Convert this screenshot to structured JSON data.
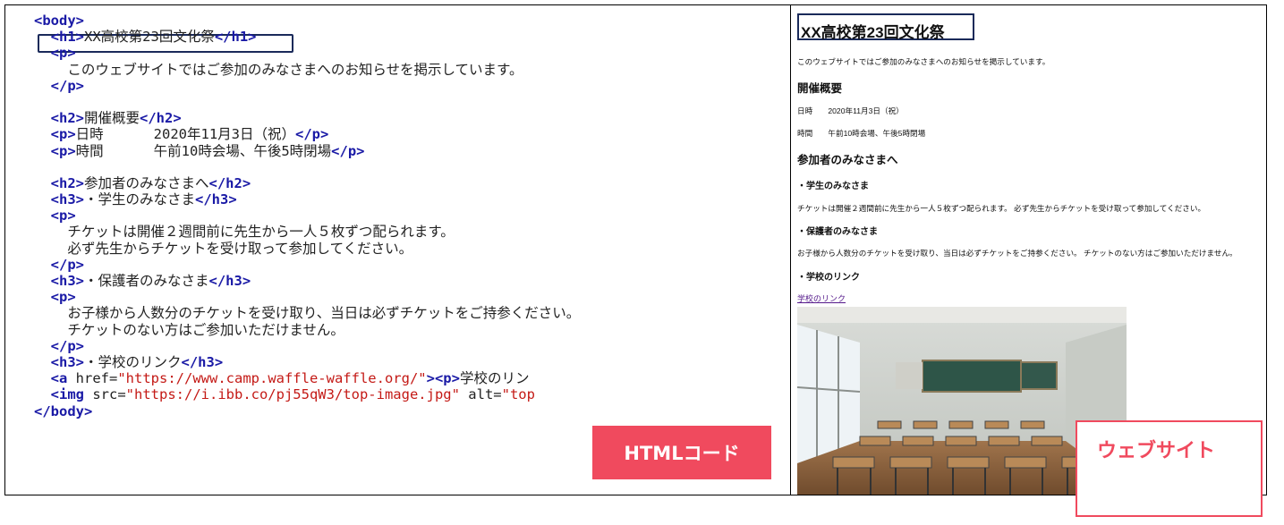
{
  "code_lines": [
    {
      "parts": [
        [
          "tag",
          "<body>"
        ]
      ],
      "indent": 0
    },
    {
      "parts": [
        [
          "tag",
          "<h1>"
        ],
        [
          "txt",
          "XX高校第23回文化祭"
        ],
        [
          "tag",
          "</h1>"
        ]
      ],
      "indent": 2
    },
    {
      "parts": [
        [
          "tag",
          "<p>"
        ]
      ],
      "indent": 2
    },
    {
      "parts": [
        [
          "txt",
          "このウェブサイトではご参加のみなさまへのお知らせを掲示しています。"
        ]
      ],
      "indent": 4
    },
    {
      "parts": [
        [
          "tag",
          "</p>"
        ]
      ],
      "indent": 2
    },
    {
      "parts": [],
      "indent": 0
    },
    {
      "parts": [
        [
          "tag",
          "<h2>"
        ],
        [
          "txt",
          "開催概要"
        ],
        [
          "tag",
          "</h2>"
        ]
      ],
      "indent": 2
    },
    {
      "parts": [
        [
          "tag",
          "<p>"
        ],
        [
          "txt",
          "日時      2020年11月3日（祝）"
        ],
        [
          "tag",
          "</p>"
        ]
      ],
      "indent": 2
    },
    {
      "parts": [
        [
          "tag",
          "<p>"
        ],
        [
          "txt",
          "時間      午前10時会場、午後5時閉場"
        ],
        [
          "tag",
          "</p>"
        ]
      ],
      "indent": 2
    },
    {
      "parts": [],
      "indent": 0
    },
    {
      "parts": [
        [
          "tag",
          "<h2>"
        ],
        [
          "txt",
          "参加者のみなさまへ"
        ],
        [
          "tag",
          "</h2>"
        ]
      ],
      "indent": 2
    },
    {
      "parts": [
        [
          "tag",
          "<h3>"
        ],
        [
          "txt",
          "・学生のみなさま"
        ],
        [
          "tag",
          "</h3>"
        ]
      ],
      "indent": 2
    },
    {
      "parts": [
        [
          "tag",
          "<p>"
        ]
      ],
      "indent": 2
    },
    {
      "parts": [
        [
          "txt",
          "チケットは開催２週間前に先生から一人５枚ずつ配られます。"
        ]
      ],
      "indent": 4
    },
    {
      "parts": [
        [
          "txt",
          "必ず先生からチケットを受け取って参加してください。"
        ]
      ],
      "indent": 4
    },
    {
      "parts": [
        [
          "tag",
          "</p>"
        ]
      ],
      "indent": 2
    },
    {
      "parts": [
        [
          "tag",
          "<h3>"
        ],
        [
          "txt",
          "・保護者のみなさま"
        ],
        [
          "tag",
          "</h3>"
        ]
      ],
      "indent": 2
    },
    {
      "parts": [
        [
          "tag",
          "<p>"
        ]
      ],
      "indent": 2
    },
    {
      "parts": [
        [
          "txt",
          "お子様から人数分のチケットを受け取り、当日は必ずチケットをご持参ください。"
        ]
      ],
      "indent": 4
    },
    {
      "parts": [
        [
          "txt",
          "チケットのない方はご参加いただけません。"
        ]
      ],
      "indent": 4
    },
    {
      "parts": [
        [
          "tag",
          "</p>"
        ]
      ],
      "indent": 2
    },
    {
      "parts": [
        [
          "tag",
          "<h3>"
        ],
        [
          "txt",
          "・学校のリンク"
        ],
        [
          "tag",
          "</h3>"
        ]
      ],
      "indent": 2
    },
    {
      "parts": [
        [
          "tag",
          "<a "
        ],
        [
          "attr",
          "href="
        ],
        [
          "str",
          "\"https://www.camp.waffle-waffle.org/\""
        ],
        [
          "tag",
          "><p>"
        ],
        [
          "txt",
          "学校のリン"
        ]
      ],
      "indent": 2
    },
    {
      "parts": [
        [
          "tag",
          "<img "
        ],
        [
          "attr",
          "src="
        ],
        [
          "str",
          "\"https://i.ibb.co/pj55qW3/top-image.jpg\""
        ],
        [
          "attr",
          " alt="
        ],
        [
          "str",
          "\"top"
        ]
      ],
      "indent": 2
    },
    {
      "parts": [
        [
          "tag",
          "</body>"
        ]
      ],
      "indent": 0
    }
  ],
  "site": {
    "h1": "XX高校第23回文化祭",
    "intro": "このウェブサイトではご参加のみなさまへのお知らせを掲示しています。",
    "h2_overview": "開催概要",
    "date_line": "日時　　2020年11月3日（祝）",
    "time_line": "時間　　午前10時会場、午後5時閉場",
    "h2_participants": "参加者のみなさまへ",
    "h3_students": "・学生のみなさま",
    "p_students": "チケットは開催２週間前に先生から一人５枚ずつ配られます。 必ず先生からチケットを受け取って参加してください。",
    "h3_parents": "・保護者のみなさま",
    "p_parents": "お子様から人数分のチケットを受け取り、当日は必ずチケットをご持参ください。 チケットのない方はご参加いただけません。",
    "h3_link": "・学校のリンク",
    "link_text": "学校のリンク",
    "photo_icon": "classroom-photo"
  },
  "labels": {
    "html_code": "HTMLコード",
    "website": "ウェブサイト"
  },
  "colors": {
    "accent": "#f04a5e",
    "tag": "#1a1aa6",
    "string": "#c41a16",
    "box": "#1a2a5a",
    "visited_link": "#551a8b"
  }
}
